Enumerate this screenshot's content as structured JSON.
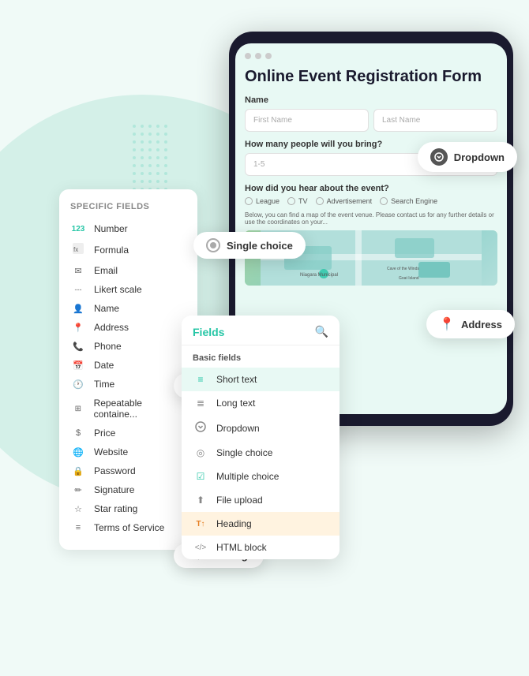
{
  "background": {
    "circle_color": "#d4f0e8"
  },
  "phone": {
    "dots": [
      "#e0e0e0",
      "#e0e0e0",
      "#e0e0e0"
    ],
    "form_title": "Online Event Registration Form",
    "name_label": "Name",
    "first_name_placeholder": "First Name",
    "last_name_placeholder": "Last Name",
    "people_label": "How many people will you bring?",
    "people_placeholder": "1-5",
    "hear_label": "How did you hear about the event?",
    "radio_options": [
      "League",
      "TV",
      "Advertisement",
      "Search Engine"
    ],
    "map_text": "Below, you can find a map of the event venue. Please contact us for any further details or use the coordinates on your..."
  },
  "tooltips": {
    "dropdown": "Dropdown",
    "address": "Address",
    "single_choice": "Single choice",
    "short_text": "Short text",
    "heading": "Heading"
  },
  "specific_fields": {
    "title": "Specific fields",
    "items": [
      {
        "icon": "123",
        "label": "Number"
      },
      {
        "icon": "fx",
        "label": "Formula"
      },
      {
        "icon": "✉",
        "label": "Email"
      },
      {
        "icon": "---",
        "label": "Likert scale"
      },
      {
        "icon": "👤",
        "label": "Name"
      },
      {
        "icon": "📍",
        "label": "Address"
      },
      {
        "icon": "📞",
        "label": "Phone"
      },
      {
        "icon": "📅",
        "label": "Date"
      },
      {
        "icon": "🕐",
        "label": "Time"
      },
      {
        "icon": "⊞",
        "label": "Repeatable container"
      },
      {
        "icon": "$",
        "label": "Price"
      },
      {
        "icon": "🌐",
        "label": "Website"
      },
      {
        "icon": "🔒",
        "label": "Password"
      },
      {
        "icon": "✏",
        "label": "Signature"
      },
      {
        "icon": "☆",
        "label": "Star rating"
      },
      {
        "icon": "≡",
        "label": "Terms of Service"
      }
    ]
  },
  "fields_panel": {
    "title": "Fields",
    "section_title": "Basic fields",
    "search_icon": "🔍",
    "items": [
      {
        "icon": "≡",
        "label": "Short text",
        "highlight": true
      },
      {
        "icon": "≣",
        "label": "Long text"
      },
      {
        "icon": "▾",
        "label": "Dropdown"
      },
      {
        "icon": "◎",
        "label": "Single choice"
      },
      {
        "icon": "☑",
        "label": "Multiple choice"
      },
      {
        "icon": "⬆",
        "label": "File upload"
      },
      {
        "icon": "T↑",
        "label": "Heading",
        "heading": true
      },
      {
        "icon": "</>",
        "label": "HTML block"
      }
    ]
  }
}
